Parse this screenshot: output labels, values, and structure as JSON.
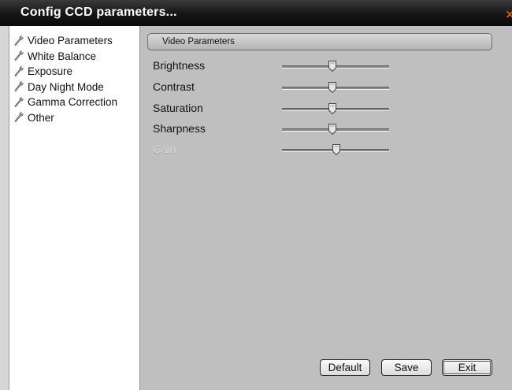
{
  "window": {
    "title": "Config CCD parameters...",
    "close_symbol": "×",
    "close_color": "#e2561b"
  },
  "sidebar": {
    "items": [
      {
        "label": "Video Parameters",
        "icon": "wrench-icon"
      },
      {
        "label": "White Balance",
        "icon": "wrench-icon"
      },
      {
        "label": "Exposure",
        "icon": "wrench-icon"
      },
      {
        "label": "Day Night Mode",
        "icon": "wrench-icon"
      },
      {
        "label": "Gamma Correction",
        "icon": "wrench-icon"
      },
      {
        "label": "Other",
        "icon": "wrench-icon"
      }
    ]
  },
  "panel": {
    "header": "Video Parameters",
    "params": [
      {
        "label": "Brightness",
        "value": 0.47,
        "enabled": true
      },
      {
        "label": "Contrast",
        "value": 0.47,
        "enabled": true
      },
      {
        "label": "Saturation",
        "value": 0.47,
        "enabled": true
      },
      {
        "label": "Sharpness",
        "value": 0.47,
        "enabled": true
      },
      {
        "label": "Gain",
        "value": 0.51,
        "enabled": false
      }
    ]
  },
  "buttons": {
    "default": "Default",
    "save": "Save",
    "exit": "Exit"
  }
}
